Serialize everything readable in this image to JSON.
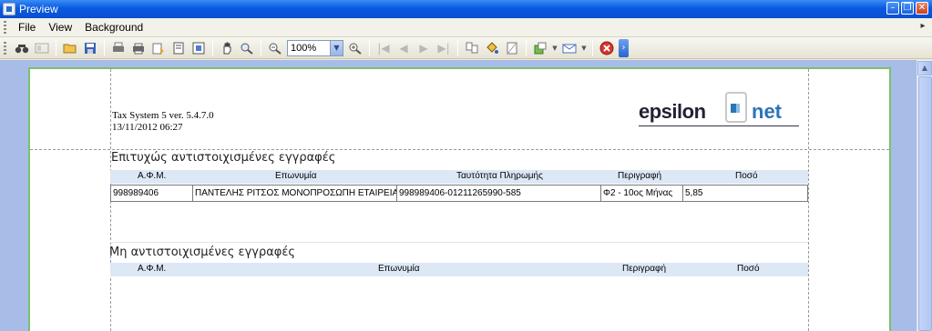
{
  "window": {
    "title": "Preview"
  },
  "menu": {
    "items": [
      {
        "label": "File"
      },
      {
        "label": "View"
      },
      {
        "label": "Background"
      }
    ]
  },
  "toolbar": {
    "zoom_value": "100%"
  },
  "report": {
    "app_version": "Tax System 5 ver. 5.4.7.0",
    "datetime": "13/11/2012 06:27",
    "logo": {
      "left": "epsilon",
      "right": "net"
    },
    "matched": {
      "title": "Επιτυχώς αντιστοιχισμένες εγγραφές",
      "columns": [
        "Α.Φ.Μ.",
        "Επωνυμία",
        "Ταυτότητα Πληρωμής",
        "Περιγραφή",
        "Ποσό"
      ],
      "rows": [
        {
          "afm": "998989406",
          "name": "ΠΑΝΤΕΛΗΣ ΡΙΤΣΟΣ ΜΟΝΟΠΡΟΣΩΠΗ ΕΤΑΙΡΕΙΑ Π",
          "payment_id": "998989406-01211265990-585",
          "description": "Φ2 - 10ος Μήνας",
          "amount": "5,85"
        }
      ]
    },
    "unmatched": {
      "title": "Μη αντιστοιχισμένες εγγραφές",
      "columns": [
        "Α.Φ.Μ.",
        "Επωνυμία",
        "Περιγραφή",
        "Ποσό"
      ]
    }
  }
}
